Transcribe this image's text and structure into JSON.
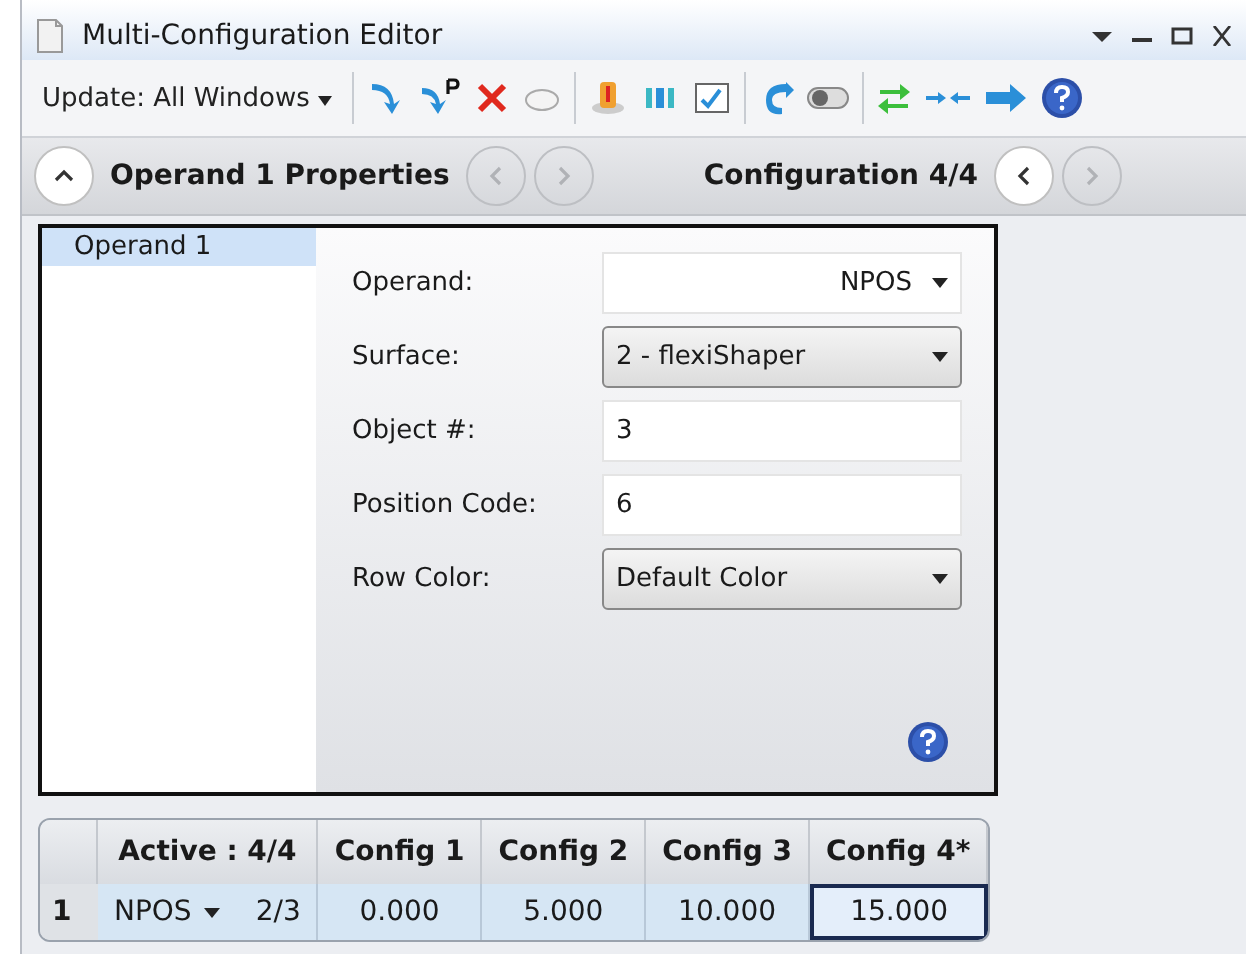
{
  "window": {
    "title": "Multi-Configuration Editor"
  },
  "toolbar": {
    "update_button": "Update: All Windows"
  },
  "nav_bar": {
    "operand_title": "Operand  1 Properties",
    "operand_nav": [
      {
        "disabled": true
      },
      {
        "disabled": true
      }
    ],
    "config_title": "Configuration 4/4",
    "config_nav": [
      {
        "disabled": false
      },
      {
        "disabled": true
      }
    ]
  },
  "operand_list": [
    {
      "label": "Operand 1",
      "selected": true
    }
  ],
  "properties": [
    {
      "label": "Operand:",
      "value": "NPOS",
      "kind": "flat-dropdown"
    },
    {
      "label": "Surface:",
      "value": "2 - flexiShaper",
      "kind": "dropdown"
    },
    {
      "label": "Object #:",
      "value": "3",
      "kind": "text"
    },
    {
      "label": "Position Code:",
      "value": "6",
      "kind": "text"
    },
    {
      "label": "Row Color:",
      "value": "Default Color",
      "kind": "dropdown"
    }
  ],
  "table": {
    "columns": [
      "",
      "Active : 4/4",
      "Config 1",
      "Config 2",
      "Config 3",
      "Config 4*"
    ],
    "rows": [
      {
        "cells": [
          {
            "kind": "number",
            "value": "1",
            "selected": false
          },
          {
            "kind": "operand",
            "operand": "NPOS",
            "count": "2/3",
            "selected": false
          },
          {
            "value": "0.000",
            "selected": false
          },
          {
            "value": "5.000",
            "selected": false
          },
          {
            "value": "10.000",
            "selected": false
          },
          {
            "value": "15.000",
            "selected": true
          }
        ]
      }
    ]
  }
}
